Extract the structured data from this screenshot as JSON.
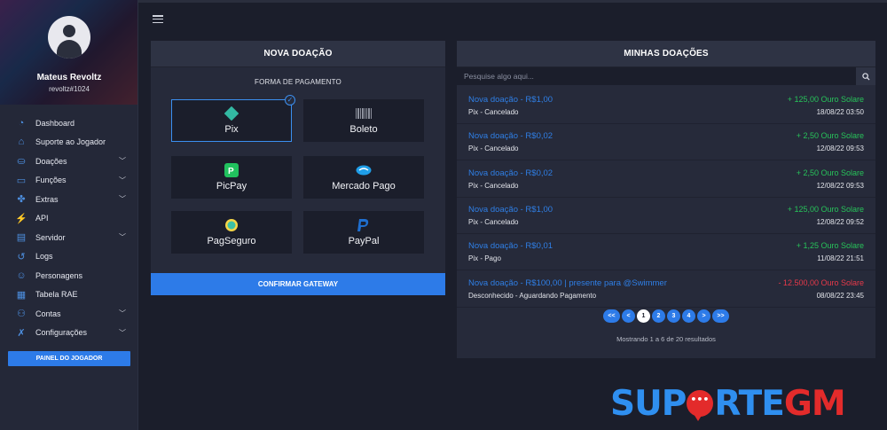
{
  "user": {
    "name": "Mateus Revoltz",
    "handle": "revoltz#1024"
  },
  "menu": [
    {
      "label": "Dashboard",
      "icon": "dashboard-icon",
      "chevron": false
    },
    {
      "label": "Suporte ao Jogador",
      "icon": "support-icon",
      "chevron": false
    },
    {
      "label": "Doações",
      "icon": "donations-icon",
      "chevron": true
    },
    {
      "label": "Funções",
      "icon": "gamepad-icon",
      "chevron": true
    },
    {
      "label": "Extras",
      "icon": "puzzle-icon",
      "chevron": true
    },
    {
      "label": "API",
      "icon": "plug-icon",
      "chevron": false
    },
    {
      "label": "Servidor",
      "icon": "server-icon",
      "chevron": true
    },
    {
      "label": "Logs",
      "icon": "history-icon",
      "chevron": false
    },
    {
      "label": "Personagens",
      "icon": "characters-icon",
      "chevron": false
    },
    {
      "label": "Tabela RAE",
      "icon": "table-icon",
      "chevron": false
    },
    {
      "label": "Contas",
      "icon": "accounts-icon",
      "chevron": true
    },
    {
      "label": "Configurações",
      "icon": "tools-icon",
      "chevron": true
    }
  ],
  "panel_button": "PAINEL DO JOGADOR",
  "new_donation": {
    "title": "NOVA DOAÇÃO",
    "payment_label": "FORMA DE PAGAMENTO",
    "gateways": [
      {
        "label": "Pix",
        "icon": "pix-icon",
        "selected": true
      },
      {
        "label": "Boleto",
        "icon": "barcode-icon",
        "selected": false
      },
      {
        "label": "PicPay",
        "icon": "picpay-icon",
        "selected": false
      },
      {
        "label": "Mercado Pago",
        "icon": "mercadopago-icon",
        "selected": false
      },
      {
        "label": "PagSeguro",
        "icon": "pagseguro-icon",
        "selected": false
      },
      {
        "label": "PayPal",
        "icon": "paypal-icon",
        "selected": false
      }
    ],
    "confirm_label": "CONFIRMAR GATEWAY"
  },
  "my_donations": {
    "title": "MINHAS DOAÇÕES",
    "search_placeholder": "Pesquise algo aqui...",
    "items": [
      {
        "title": "Nova doação - R$1,00",
        "status": "Pix - Cancelado",
        "amount": "+ 125,00 Ouro Solare",
        "date": "18/08/22 03:50",
        "negative": false
      },
      {
        "title": "Nova doação - R$0,02",
        "status": "Pix - Cancelado",
        "amount": "+ 2,50 Ouro Solare",
        "date": "12/08/22 09:53",
        "negative": false
      },
      {
        "title": "Nova doação - R$0,02",
        "status": "Pix - Cancelado",
        "amount": "+ 2,50 Ouro Solare",
        "date": "12/08/22 09:53",
        "negative": false
      },
      {
        "title": "Nova doação - R$1,00",
        "status": "Pix - Cancelado",
        "amount": "+ 125,00 Ouro Solare",
        "date": "12/08/22 09:52",
        "negative": false
      },
      {
        "title": "Nova doação - R$0,01",
        "status": "Pix - Pago",
        "amount": "+ 1,25 Ouro Solare",
        "date": "11/08/22 21:51",
        "negative": false
      },
      {
        "title": "Nova doação - R$100,00 | presente para @Swimmer",
        "status": "Desconhecido - Aguardando Pagamento",
        "amount": "- 12.500,00 Ouro Solare",
        "date": "08/08/22 23:45",
        "negative": true
      }
    ],
    "pagination": [
      "<<",
      "<",
      "1",
      "2",
      "3",
      "4",
      ">",
      ">>"
    ],
    "current_page": "1",
    "result_info": "Mostrando 1 a 6 de 20 resultados"
  },
  "logo": {
    "part1": "SUP",
    "part2": "RTE",
    "part3": "GM"
  },
  "colors": {
    "accent": "#2d7be8",
    "positive": "#27c35a",
    "negative": "#e8394a",
    "background": "#1b1e2b",
    "card": "#262a3a"
  }
}
